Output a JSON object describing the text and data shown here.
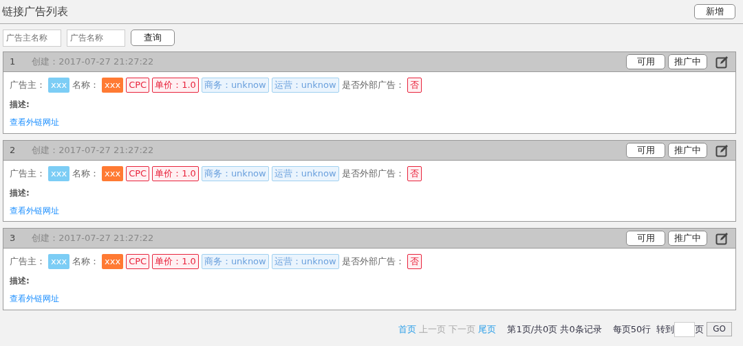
{
  "page": {
    "title": "链接广告列表",
    "add_button": "新增"
  },
  "search": {
    "fields": [
      {
        "placeholder": "广告主名称"
      },
      {
        "placeholder": "广告名称"
      }
    ],
    "button": "查询"
  },
  "ads": [
    {
      "index": "1",
      "created": "创建：2017-07-27 21:27:22",
      "actions": [
        "可用",
        "推广中"
      ],
      "items": [
        {
          "kind": "label",
          "text": "广告主："
        },
        {
          "kind": "solid-blue",
          "text": "xxx"
        },
        {
          "kind": "label",
          "text": "名称："
        },
        {
          "kind": "solid-orange",
          "text": "xxx"
        },
        {
          "kind": "outline-red",
          "text": "CPC"
        },
        {
          "kind": "outline-red",
          "text": "单价：1.0"
        },
        {
          "kind": "outline-blue",
          "text": "商务：unknow"
        },
        {
          "kind": "outline-blue",
          "text": "运营：unknow"
        },
        {
          "kind": "label",
          "text": "是否外部广告："
        },
        {
          "kind": "outline-red",
          "text": "否"
        }
      ],
      "description_label": "描述:",
      "link": "查看外链网址"
    },
    {
      "index": "2",
      "created": "创建：2017-07-27 21:27:22",
      "actions": [
        "可用",
        "推广中"
      ],
      "items": [
        {
          "kind": "label",
          "text": "广告主："
        },
        {
          "kind": "solid-blue",
          "text": "xxx"
        },
        {
          "kind": "label",
          "text": "名称："
        },
        {
          "kind": "solid-orange",
          "text": "xxx"
        },
        {
          "kind": "outline-red",
          "text": "CPC"
        },
        {
          "kind": "outline-red",
          "text": "单价：1.0"
        },
        {
          "kind": "outline-blue",
          "text": "商务：unknow"
        },
        {
          "kind": "outline-blue",
          "text": "运营：unknow"
        },
        {
          "kind": "label",
          "text": "是否外部广告："
        },
        {
          "kind": "outline-red",
          "text": "否"
        }
      ],
      "description_label": "描述:",
      "link": "查看外链网址"
    },
    {
      "index": "3",
      "created": "创建：2017-07-27 21:27:22",
      "actions": [
        "可用",
        "推广中"
      ],
      "items": [
        {
          "kind": "label",
          "text": "广告主："
        },
        {
          "kind": "solid-blue",
          "text": "xxx"
        },
        {
          "kind": "label",
          "text": "名称："
        },
        {
          "kind": "solid-orange",
          "text": "xxx"
        },
        {
          "kind": "outline-red",
          "text": "CPC"
        },
        {
          "kind": "outline-red",
          "text": "单价：1.0"
        },
        {
          "kind": "outline-blue",
          "text": "商务：unknow"
        },
        {
          "kind": "outline-blue",
          "text": "运营：unknow"
        },
        {
          "kind": "label",
          "text": "是否外部广告："
        },
        {
          "kind": "outline-red",
          "text": "否"
        }
      ],
      "description_label": "描述:",
      "link": "查看外链网址"
    }
  ],
  "pagination": {
    "links": [
      {
        "text": "首页",
        "disabled": false
      },
      {
        "text": "上一页",
        "disabled": true
      },
      {
        "text": "下一页",
        "disabled": true
      },
      {
        "text": "尾页",
        "disabled": false
      }
    ],
    "summary": "第1页/共0页 共0条记录",
    "per_page": "每页50行",
    "goto_label": "转到",
    "page_suffix": "页",
    "go_button": "GO"
  }
}
